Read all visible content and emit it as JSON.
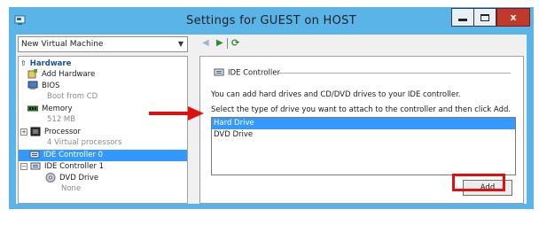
{
  "window": {
    "title": "Settings for GUEST on HOST",
    "close_glyph": "x"
  },
  "toolbar": {
    "vm_select_value": "New Virtual Machine"
  },
  "tree": {
    "hardware_header": "Hardware",
    "items": [
      {
        "label": "Add Hardware",
        "sub": ""
      },
      {
        "label": "BIOS",
        "sub": "Boot from CD"
      },
      {
        "label": "Memory",
        "sub": "512 MB"
      },
      {
        "label": "Processor",
        "sub": "4 Virtual processors"
      },
      {
        "label": "IDE Controller 0",
        "sub": ""
      },
      {
        "label": "IDE Controller 1",
        "sub": ""
      },
      {
        "label": "DVD Drive",
        "sub": "None"
      }
    ]
  },
  "pane": {
    "group_title": "IDE Controller",
    "description": "You can add hard drives and CD/DVD drives to your IDE controller.",
    "instruction": "Select the type of drive you want to attach to the controller and then click Add.",
    "drive_options": [
      "Hard Drive",
      "DVD Drive"
    ],
    "selected_option": "Hard Drive",
    "add_button": "Add"
  },
  "colors": {
    "title_bar": "#5ab4e8",
    "selection": "#3399ff",
    "annotation": "#e01010",
    "close_button": "#c0392b"
  }
}
